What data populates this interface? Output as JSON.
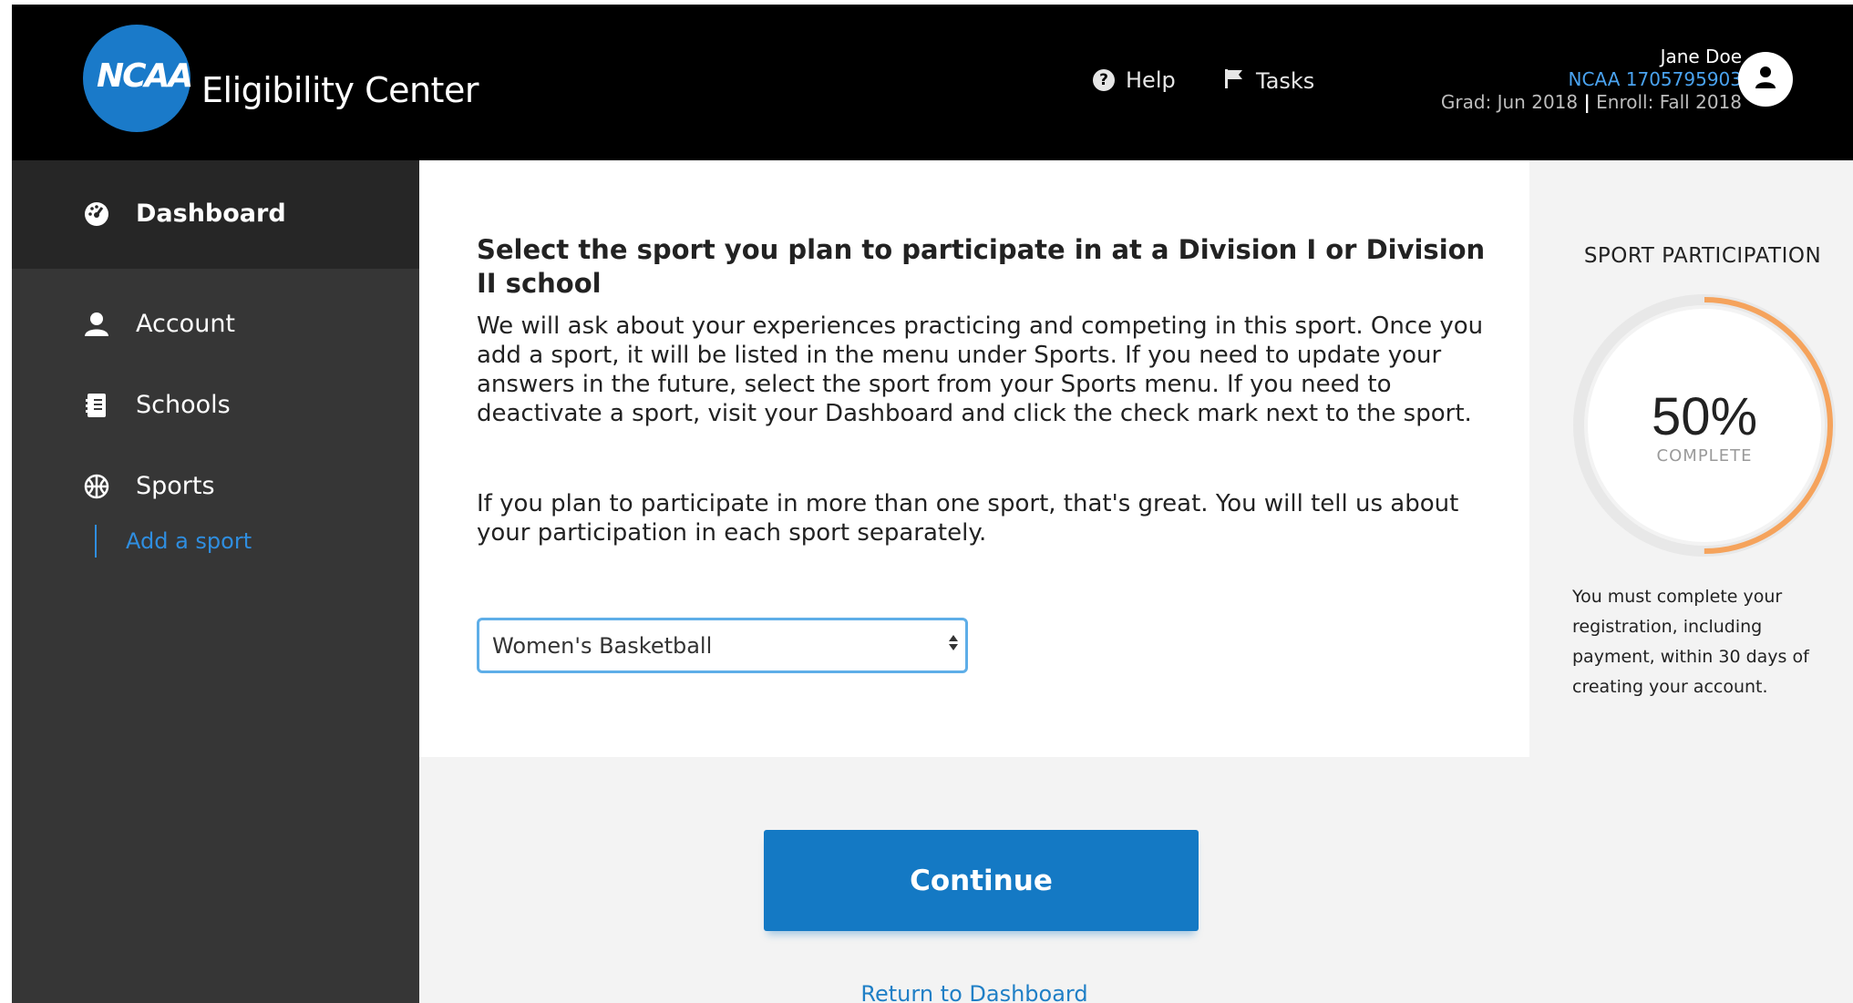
{
  "brand": {
    "logo_text": "NCAA",
    "title": "Eligibility Center"
  },
  "header": {
    "help_label": "Help",
    "tasks_label": "Tasks",
    "user": {
      "name": "Jane Doe",
      "ncaa_id": "NCAA 1705795903",
      "grad": "Grad: Jun 2018",
      "separator": "|",
      "enroll": "Enroll: Fall 2018"
    }
  },
  "sidebar": {
    "items": [
      {
        "label": "Dashboard",
        "icon": "dashboard-gauge-icon",
        "active": true
      },
      {
        "label": "Account",
        "icon": "user-icon"
      },
      {
        "label": "Schools",
        "icon": "schools-book-icon"
      },
      {
        "label": "Sports",
        "icon": "globe-ball-icon"
      }
    ],
    "sub_link": "Add a sport"
  },
  "main": {
    "heading": "Select the sport you plan to participate in at a Division I or Division II school",
    "paragraph1": "We will ask about your experiences practicing and competing in this sport. Once you add a sport, it will be listed in the menu under Sports. If you need to update your answers in the future, select the sport from your Sports menu. If you need to deactivate a sport, visit your Dashboard and click the check mark next to the sport.",
    "paragraph2": "If you plan to participate in more than one sport, that's great. You will tell us about your participation in each sport separately.",
    "sport_select": {
      "selected": "Women's Basketball"
    },
    "continue_label": "Continue",
    "return_link": "Return to Dashboard"
  },
  "progress": {
    "title": "SPORT PARTICIPATION",
    "percent_text": "50%",
    "percent": 50,
    "complete_label": "COMPLETE",
    "note": "You must complete your registration, including payment, within 30 days of creating your account."
  },
  "colors": {
    "header_bg": "#000000",
    "sidebar_bg": "#363636",
    "accent_blue": "#1479c4",
    "link_blue": "#2f8ee0",
    "progress_orange": "#f5a35c"
  }
}
